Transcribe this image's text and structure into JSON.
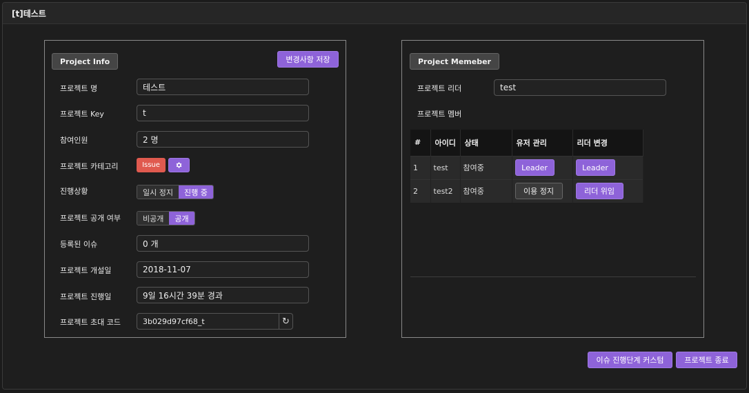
{
  "window": {
    "title": "[t]테스트"
  },
  "info": {
    "tab_label": "Project Info",
    "save_label": "변경사항 저장",
    "fields": [
      {
        "label": "프로젝트 명",
        "value": "테스트"
      },
      {
        "label": "프로젝트 Key",
        "value": "t"
      },
      {
        "label": "참여인원",
        "value": "2 명"
      },
      {
        "label": "프로젝트 카테고리"
      },
      {
        "label": "진행상황"
      },
      {
        "label": "프로젝트 공개 여부"
      },
      {
        "label": "등록된 이슈",
        "value": "0 개"
      },
      {
        "label": "프로젝트 개설일",
        "value": "2018-11-07"
      },
      {
        "label": "프로젝트 진행일",
        "value": "9일 16시간 39분 경과"
      },
      {
        "label": "프로젝트 초대 코드",
        "value": "3b029d97cf68_t"
      }
    ],
    "category_chip": "Issue",
    "progress": {
      "options": [
        "일시 정지",
        "진행 중"
      ],
      "selected": "진행 중"
    },
    "visibility": {
      "options": [
        "비공개",
        "공개"
      ],
      "selected": "공개"
    }
  },
  "member": {
    "tab_label": "Project Memeber",
    "leader_label": "프로젝트 리더",
    "leader_value": "test",
    "members_label": "프로젝트 멤버",
    "columns": [
      "#",
      "아이디",
      "상태",
      "유저 관리",
      "리더 변경"
    ],
    "rows": [
      {
        "num": "1",
        "id": "test",
        "status": "참여중",
        "manage": "Leader",
        "leader": "Leader"
      },
      {
        "num": "2",
        "id": "test2",
        "status": "참여중",
        "manage": "이용 정지",
        "leader": "리더 위임"
      }
    ]
  },
  "footer": {
    "customize_label": "이슈 진행단계 커스텀",
    "close_label": "프로젝트 종료"
  },
  "colors": {
    "accent": "#8e63d9",
    "danger": "#e05a4f",
    "background": "#1e1e1e"
  }
}
